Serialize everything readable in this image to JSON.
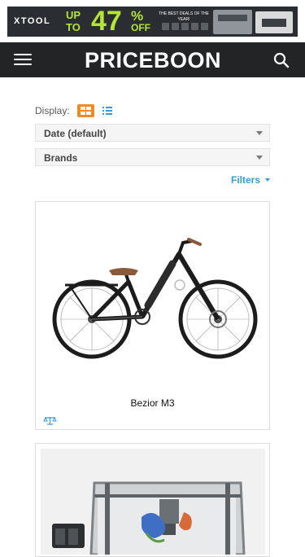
{
  "ad": {
    "brand": "XTOOL",
    "upto": "UP TO",
    "percent": "47",
    "percent_sign": "%",
    "off": "OFF",
    "tagline": "THE BEST DEALS OF THE YEAR!"
  },
  "header": {
    "logo": "PRICEBOON",
    "menu_icon": "hamburger-menu-icon",
    "search_icon": "search-icon"
  },
  "controls": {
    "display_label": "Display:",
    "grid_view_icon": "grid-view-icon",
    "list_view_icon": "list-view-icon",
    "sort_value": "Date (default)",
    "brands_value": "Brands",
    "filters_label": "Filters"
  },
  "products": [
    {
      "title": "Bezior M3",
      "compare_icon": "scale-compare-icon"
    },
    {
      "title": ""
    }
  ],
  "colors": {
    "header_bg": "#222426",
    "accent_orange": "#f08a24",
    "accent_blue": "#3a9ad9",
    "ad_green": "#b4e635"
  }
}
